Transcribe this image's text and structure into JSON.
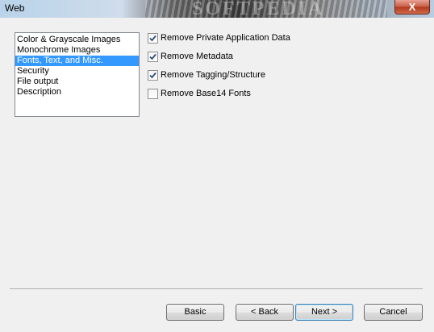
{
  "window": {
    "title": "Web",
    "close_glyph": "X",
    "watermark": "SOFTPEDIA"
  },
  "categories": {
    "items": [
      {
        "label": "Color & Grayscale Images",
        "selected": false
      },
      {
        "label": "Monochrome Images",
        "selected": false
      },
      {
        "label": "Fonts, Text, and Misc.",
        "selected": true
      },
      {
        "label": "Security",
        "selected": false
      },
      {
        "label": "File output",
        "selected": false
      },
      {
        "label": "Description",
        "selected": false
      }
    ]
  },
  "options": [
    {
      "label": "Remove Private Application Data",
      "checked": true
    },
    {
      "label": "Remove Metadata",
      "checked": true
    },
    {
      "label": "Remove Tagging/Structure",
      "checked": true
    },
    {
      "label": "Remove Base14 Fonts",
      "checked": false
    }
  ],
  "buttons": {
    "basic": "Basic",
    "back": "< Back",
    "next": "Next >",
    "cancel": "Cancel"
  },
  "colors": {
    "selection": "#3399ff",
    "check": "#2c4f7a"
  }
}
